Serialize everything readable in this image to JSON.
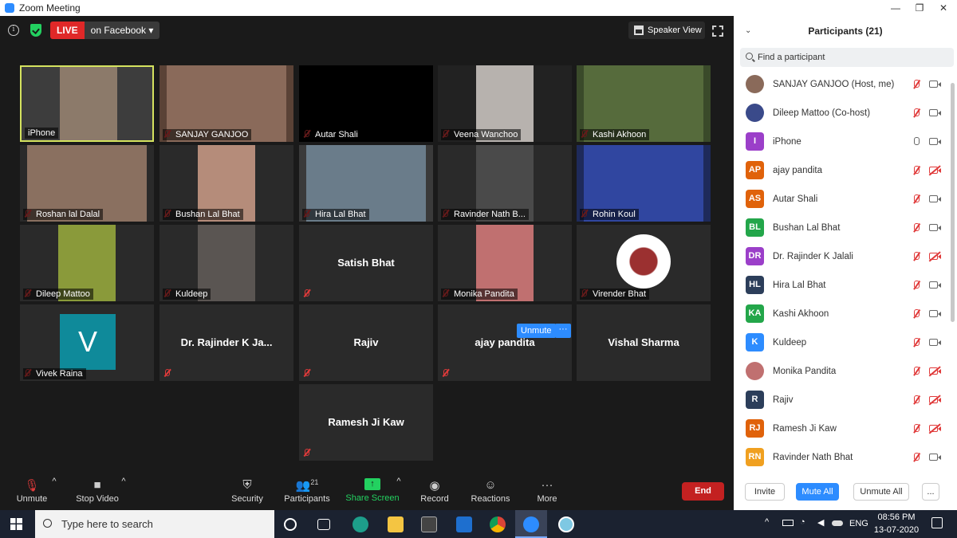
{
  "window": {
    "title": "Zoom Meeting",
    "minimize": "—",
    "maximize": "❐",
    "close": "✕"
  },
  "topbar": {
    "info_icon": "i",
    "live_label": "LIVE",
    "live_target": "on Facebook",
    "live_caret": "▾",
    "speaker_view": "Speaker View"
  },
  "tiles": [
    {
      "name": "iPhone",
      "bg": "#3d3d3d",
      "video": "#8c7a6a",
      "muted": false,
      "active": true
    },
    {
      "name": "SANJAY GANJOO",
      "bg": "#5a4236",
      "video": "#8a6a5a",
      "muted": true
    },
    {
      "name": "Autar Shali",
      "bg": "#000000",
      "video": "#000000",
      "muted": true
    },
    {
      "name": "Veena Wanchoo",
      "bg": "#222222",
      "video": "#b7b2ae",
      "muted": true
    },
    {
      "name": "Kashi Akhoon",
      "bg": "#3a4a2a",
      "video": "#566b3c",
      "muted": true
    },
    {
      "name": "Roshan lal Dalal",
      "bg": "#2a2a2a",
      "video": "#8a7060",
      "muted": true
    },
    {
      "name": "Bushan Lal Bhat",
      "bg": "#2a2a2a",
      "video": "#b58c7a",
      "muted": true
    },
    {
      "name": "Hira Lal Bhat",
      "bg": "#3a3a3a",
      "video": "#6a7c8a",
      "muted": true
    },
    {
      "name": "Ravinder Nath B...",
      "bg": "#2a2a2a",
      "video": "#4a4a4a",
      "muted": true
    },
    {
      "name": "Rohin Koul",
      "bg": "#1e2a5a",
      "video": "#3046a0",
      "muted": true
    },
    {
      "name": "Dileep Mattoo",
      "bg": "#2a2a2a",
      "video": "#8a9a3a",
      "muted": true
    },
    {
      "name": "Kuldeep",
      "bg": "#2a2a2a",
      "video": "#5a5552",
      "muted": true
    },
    {
      "name": "",
      "label": "Satish Bhat",
      "bg": "#2a2a2a",
      "video": "",
      "muted": true
    },
    {
      "name": "Monika Pandita",
      "bg": "#2a2a2a",
      "video": "#c07070",
      "muted": true
    },
    {
      "name": "Virender Bhat",
      "bg": "#2a2a2a",
      "video": "#ffffff",
      "muted": true
    },
    {
      "name": "Vivek Raina",
      "bg": "#2a2a2a",
      "video": "#0f8a9a",
      "letter": "V",
      "muted": true
    },
    {
      "name": "",
      "label": "Dr. Rajinder K Ja...",
      "bg": "#2a2a2a",
      "video": "",
      "muted": true
    },
    {
      "name": "",
      "label": "Rajiv",
      "bg": "#2a2a2a",
      "video": "",
      "muted": true
    },
    {
      "name": "",
      "label": "ajay pandita",
      "bg": "#2a2a2a",
      "video": "",
      "muted": true
    },
    {
      "name": "",
      "label": "Vishal Sharma",
      "bg": "#2a2a2a",
      "video": "",
      "muted": false
    },
    {
      "name": "",
      "label": "Ramesh Ji Kaw",
      "bg": "#2a2a2a",
      "video": "",
      "muted": true
    }
  ],
  "hover_actions": {
    "unmute": "Unmute",
    "more": "···"
  },
  "toolbar": {
    "unmute": "Unmute",
    "stop_video": "Stop Video",
    "security": "Security",
    "participants": "Participants",
    "participant_count": "21",
    "share_screen": "Share Screen",
    "record": "Record",
    "reactions": "Reactions",
    "more": "More",
    "end": "End",
    "caret": "^",
    "more_dots": "···"
  },
  "panel": {
    "title": "Participants (21)",
    "collapse": "⌄",
    "search_placeholder": "Find a participant",
    "participants": [
      {
        "name": "SANJAY GANJOO (Host, me)",
        "initials": "",
        "color": "#8a6a5a",
        "mic_on": false,
        "cam_on": true
      },
      {
        "name": "Dileep Mattoo (Co-host)",
        "initials": "",
        "color": "#3a4a8a",
        "mic_on": false,
        "cam_on": true
      },
      {
        "name": "iPhone",
        "initials": "I",
        "color": "#9b3fc9",
        "mic_on": true,
        "cam_on": true
      },
      {
        "name": "ajay pandita",
        "initials": "AP",
        "color": "#e0620a",
        "mic_on": false,
        "cam_on": false
      },
      {
        "name": "Autar Shali",
        "initials": "AS",
        "color": "#e0620a",
        "mic_on": false,
        "cam_on": true
      },
      {
        "name": "Bushan Lal Bhat",
        "initials": "BL",
        "color": "#23a64a",
        "mic_on": false,
        "cam_on": true
      },
      {
        "name": "Dr. Rajinder K Jalali",
        "initials": "DR",
        "color": "#9b3fc9",
        "mic_on": false,
        "cam_on": false
      },
      {
        "name": "Hira Lal Bhat",
        "initials": "HL",
        "color": "#2c3e5a",
        "mic_on": false,
        "cam_on": true
      },
      {
        "name": "Kashi Akhoon",
        "initials": "KA",
        "color": "#23a64a",
        "mic_on": false,
        "cam_on": true
      },
      {
        "name": "Kuldeep",
        "initials": "K",
        "color": "#2d8cff",
        "mic_on": false,
        "cam_on": true
      },
      {
        "name": "Monika Pandita",
        "initials": "",
        "color": "#c07070",
        "mic_on": false,
        "cam_on": false
      },
      {
        "name": "Rajiv",
        "initials": "R",
        "color": "#2c3e5a",
        "mic_on": false,
        "cam_on": false
      },
      {
        "name": "Ramesh Ji Kaw",
        "initials": "RJ",
        "color": "#e0620a",
        "mic_on": false,
        "cam_on": false
      },
      {
        "name": "Ravinder Nath Bhat",
        "initials": "RN",
        "color": "#f0a020",
        "mic_on": false,
        "cam_on": true
      }
    ],
    "invite": "Invite",
    "mute_all": "Mute All",
    "unmute_all": "Unmute All",
    "more": "..."
  },
  "taskbar": {
    "search_placeholder": "Type here to search",
    "lang": "ENG",
    "time": "08:56 PM",
    "date": "13-07-2020"
  },
  "colors": {
    "accent": "#2d8cff",
    "live": "#e02828",
    "end": "#c32121",
    "active_speaker": "#d5e35f"
  }
}
